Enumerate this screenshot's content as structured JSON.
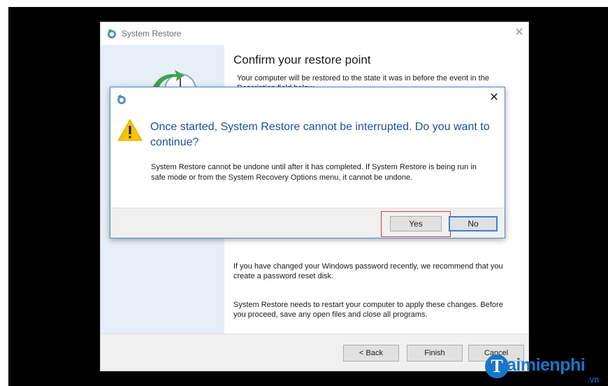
{
  "wizard": {
    "title": "System Restore",
    "close_glyph": "✕",
    "heading": "Confirm your restore point",
    "description": "Your computer will be restored to the state it was in before the event in the Description field below.",
    "password_note": "If you have changed your Windows password recently, we recommend that you create a password reset disk.",
    "restart_note": "System Restore needs to restart your computer to apply these changes. Before you proceed, save any open files and close all programs.",
    "buttons": {
      "back": "< Back",
      "finish": "Finish",
      "cancel": "Cancel"
    }
  },
  "dialog": {
    "close_glyph": "✕",
    "main_instruction": "Once started, System Restore cannot be interrupted. Do you want to continue?",
    "body": "System Restore cannot be undone until after it has completed. If System Restore is being run in safe mode or from the System Recovery Options menu, it cannot be undone.",
    "buttons": {
      "yes": "Yes",
      "no": "No"
    }
  },
  "watermark": {
    "letter": "T",
    "text": "aimienphi",
    "suffix": ".vn"
  },
  "colors": {
    "accent": "#1c4fa0",
    "dialog_border": "#4a8bd4",
    "highlight_box": "#c94040",
    "warning": "#f5c400",
    "sidebar": "#e6eef8"
  },
  "icons": {
    "title_icon": "system-restore-icon",
    "warning_icon": "warning-triangle-icon",
    "side_art": "restore-clock-arrow-icon"
  }
}
